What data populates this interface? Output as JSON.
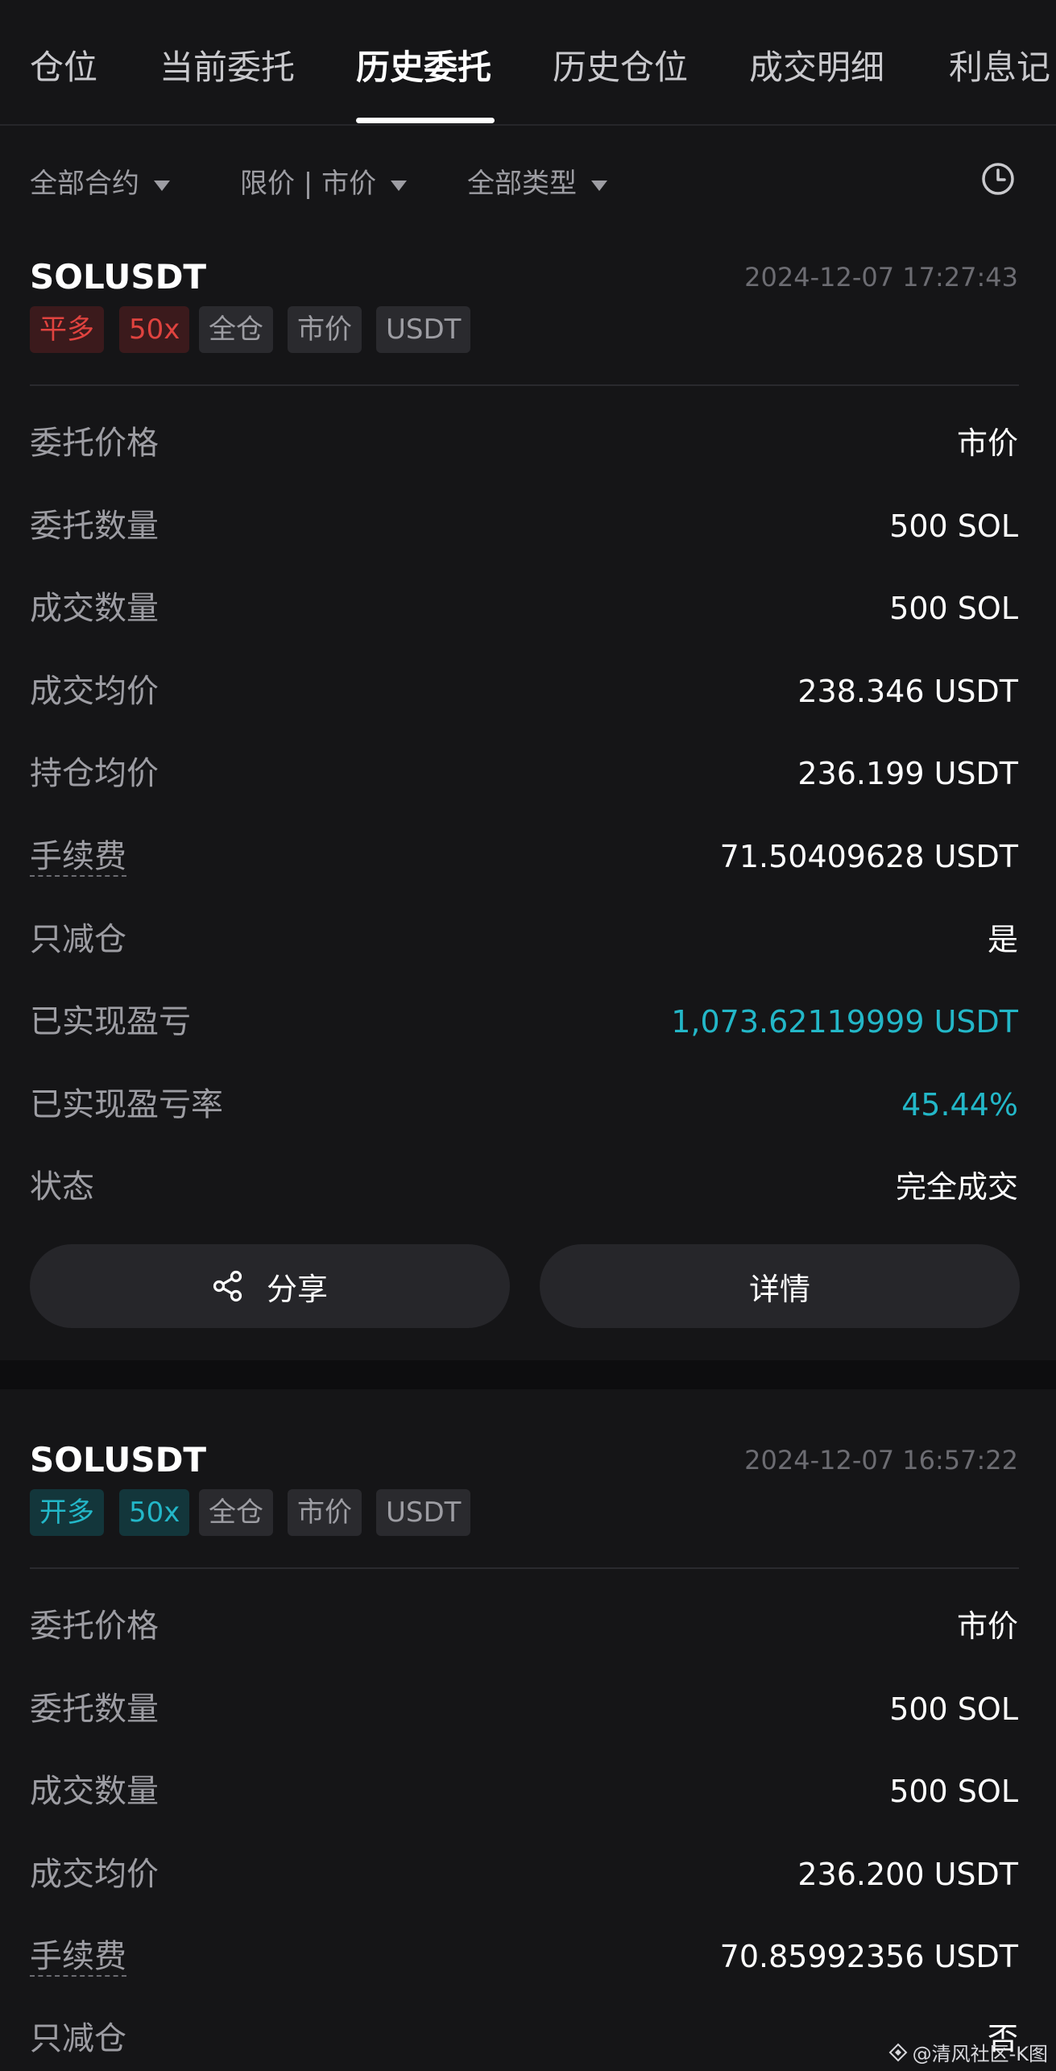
{
  "tabs": [
    {
      "label": "仓位",
      "active": false
    },
    {
      "label": "当前委托",
      "active": false
    },
    {
      "label": "历史委托",
      "active": true
    },
    {
      "label": "历史仓位",
      "active": false
    },
    {
      "label": "成交明细",
      "active": false
    },
    {
      "label": "利息记",
      "active": false
    }
  ],
  "filters": {
    "contract": "全部合约",
    "price_type": "限价 | 市价",
    "order_type": "全部类型",
    "history_icon": "clock-icon"
  },
  "orders": [
    {
      "symbol": "SOLUSDT",
      "time": "2024-12-07 17:27:43",
      "tags": [
        "平多",
        "50x",
        "全仓",
        "市价",
        "USDT"
      ],
      "side_color": "#e0433f",
      "rows": [
        {
          "label": "委托价格",
          "value": "市价"
        },
        {
          "label": "委托数量",
          "value": "500 SOL"
        },
        {
          "label": "成交数量",
          "value": "500 SOL"
        },
        {
          "label": "成交均价",
          "value": "238.346 USDT"
        },
        {
          "label": "持仓均价",
          "value": "236.199 USDT"
        },
        {
          "label": "手续费",
          "value": "71.50409628 USDT"
        },
        {
          "label": "只减仓",
          "value": "是"
        },
        {
          "label": "已实现盈亏",
          "value": "1,073.62119999 USDT"
        },
        {
          "label": "已实现盈亏率",
          "value": "45.44%"
        },
        {
          "label": "状态",
          "value": "完全成交"
        }
      ],
      "share_label": "分享",
      "detail_label": "详情"
    },
    {
      "symbol": "SOLUSDT",
      "time": "2024-12-07 16:57:22",
      "tags": [
        "开多",
        "50x",
        "全仓",
        "市价",
        "USDT"
      ],
      "side_color": "#23b7c8",
      "rows": [
        {
          "label": "委托价格",
          "value": "市价"
        },
        {
          "label": "委托数量",
          "value": "500 SOL"
        },
        {
          "label": "成交数量",
          "value": "500 SOL"
        },
        {
          "label": "成交均价",
          "value": "236.200 USDT"
        },
        {
          "label": "手续费",
          "value": "70.85992356 USDT"
        },
        {
          "label": "只减仓",
          "value": "否"
        }
      ]
    }
  ],
  "colors": {
    "background": "#151517",
    "profit": "#23b7c8",
    "loss_tag": "#e0433f"
  },
  "watermark": "@清风社区-K图"
}
